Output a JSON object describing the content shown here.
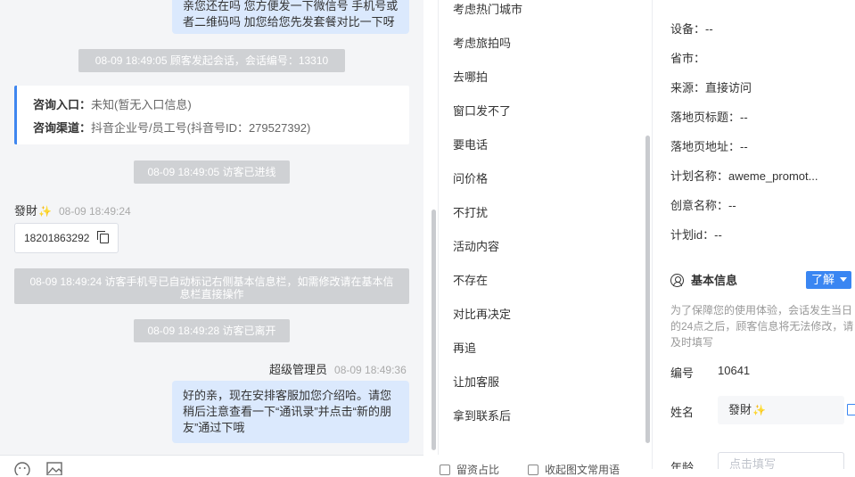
{
  "chat": {
    "top_bubble_text": "亲您还在吗 您方便发一下微信号 手机号或者二维码吗 加您给您先发套餐对比一下呀",
    "sys_start": "08-09 18:49:05 顾客发起会话，会话编号：13310",
    "entry": {
      "label": "咨询入口：",
      "value": "未知(暂无入口信息)"
    },
    "channel": {
      "label": "咨询渠道：",
      "value": "抖音企业号/员工号(抖音号ID：279527392)"
    },
    "sys_enter": "08-09 18:49:05 访客已进线",
    "visitor": {
      "name": "發財",
      "emoji": "✨",
      "time": "08-09 18:49:24"
    },
    "phone": "18201863292",
    "sys_phone_note": "08-09 18:49:24 访客手机号已自动标记右侧基本信息栏，如需修改请在基本信息栏直接操作",
    "sys_leave": "08-09 18:49:28 访客已离开",
    "agent": {
      "name": "超级管理员",
      "time": "08-09 18:49:36"
    },
    "agent_message": "好的亲，现在安排客服加您介绍哈。请您稍后注意查看一下“通讯录”并点击“新的朋友”通过下哦"
  },
  "quick_replies": [
    "考虑热门城市",
    "考虑旅拍吗",
    "去哪拍",
    "窗口发不了",
    "要电话",
    "问价格",
    "不打扰",
    "活动内容",
    "不存在",
    "对比再决定",
    "再追",
    "让加客服",
    "拿到联系后"
  ],
  "quick_toolbar": {
    "option1": "留资占比",
    "option2": "收起图文常用语"
  },
  "visit_info": {
    "device": {
      "label": "设备：",
      "value": "--"
    },
    "province": {
      "label": "省市：",
      "value": ""
    },
    "source": {
      "label": "来源：",
      "value": "直接访问"
    },
    "landing_title": {
      "label": "落地页标题：",
      "value": "--"
    },
    "landing_url": {
      "label": "落地页地址：",
      "value": "--"
    },
    "plan_name": {
      "label": "计划名称：",
      "value": "aweme_promot..."
    },
    "creative_name": {
      "label": "创意名称：",
      "value": "--"
    },
    "plan_id": {
      "label": "计划id：",
      "value": "--"
    }
  },
  "basic_info": {
    "title": "基本信息",
    "learn_more": "了解",
    "notice": "为了保障您的使用体验，会话发生当日的24点之后，顾客信息将无法修改，请及时填写",
    "number_label": "编号",
    "number_value": "10641",
    "name_label": "姓名",
    "name_value": "發財",
    "name_emoji": "✨",
    "age_label": "年龄",
    "age_placeholder": "点击填写"
  },
  "colors": {
    "accent": "#3a86f2",
    "bubble": "#dbe9fd",
    "system_pill": "#cfd1d4",
    "chat_bg": "#f4f5f7"
  }
}
